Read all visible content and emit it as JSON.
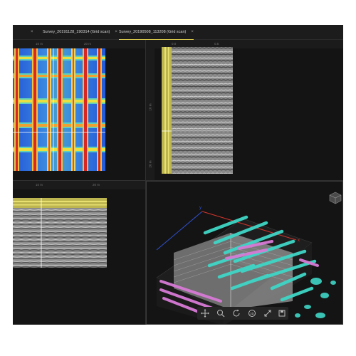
{
  "tabs": [
    {
      "label": "Survey_20191128_190314 (Grid scan)",
      "active": false
    },
    {
      "label": "Survey_20190508_113208 (Grid scan)",
      "active": true
    }
  ],
  "close_glyph": "×",
  "top_left_view": {
    "ruler_ticks": [
      "10 m",
      "20 m"
    ]
  },
  "top_right_view": {
    "top_ticks": [
      "0.0",
      "0.5"
    ],
    "left_ticks": [
      "10 m",
      "20 m"
    ]
  },
  "bottom_left_view": {
    "ruler_ticks": [
      "10 m",
      "20 m"
    ]
  },
  "toolbar": {
    "tools": [
      "move-icon",
      "zoom-icon",
      "rotate-icon",
      "view-3d-icon",
      "fit-icon",
      "save-icon"
    ]
  },
  "colors": {
    "accent": "#d8c84a",
    "rebar_cyan": "#3fd6c6",
    "rebar_magenta": "#d77ad6",
    "axis_red": "#d0342c",
    "axis_blue": "#3050d0"
  }
}
